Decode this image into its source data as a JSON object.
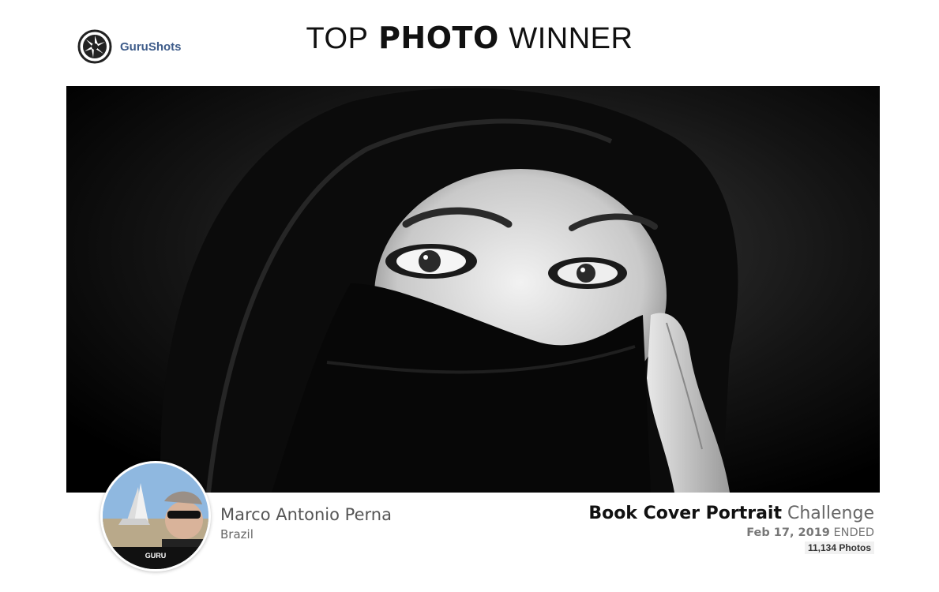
{
  "brand": {
    "name": "GuruShots",
    "logo_icon": "camera-shutter-icon"
  },
  "headline": {
    "part1": "TOP",
    "part2": "PHOTO",
    "part3": "WINNER"
  },
  "photo": {
    "subject": "winning-photo"
  },
  "author": {
    "name": "Marco Antonio Perna",
    "country": "Brazil",
    "badge": "GURU"
  },
  "challenge": {
    "name_bold": "Book Cover Portrait",
    "name_suffix": "Challenge",
    "date": "Feb 17, 2019",
    "status": "ENDED",
    "photos_count": "11,134 Photos"
  },
  "colors": {
    "brand_text": "#3e5c8a",
    "background": "#ffffff"
  }
}
